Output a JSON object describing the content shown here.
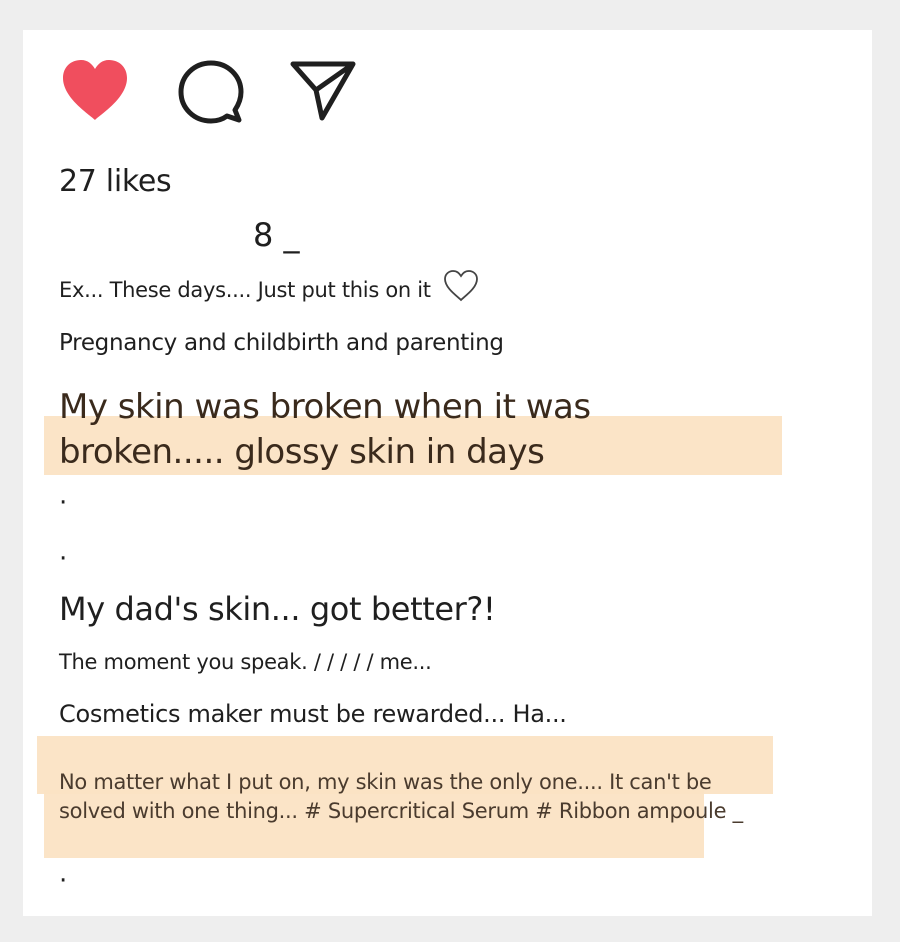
{
  "post": {
    "actions": {
      "like_icon": "heart-filled-icon",
      "comment_icon": "comment-bubble-icon",
      "share_icon": "send-icon",
      "like_color": "#f04e5e"
    },
    "likes": "27 likes",
    "username": "8 _",
    "caption": {
      "line1": "Ex... These days.... Just put this on it",
      "line2": "Pregnancy and childbirth and parenting",
      "headline": "My skin was broken when it was broken..... glossy skin in days",
      "dot": "·",
      "subhead": "My dad's skin... got better?!",
      "line3": "The moment you speak. / / / / / me...",
      "line4": "Cosmetics maker must be rewarded... Ha...",
      "paragraph": "No matter what I put on, my skin was the only one.... It can't be solved with one thing... # Supercritical Serum # Ribbon ampoule _"
    },
    "highlight_color": "#fbe3c4"
  }
}
